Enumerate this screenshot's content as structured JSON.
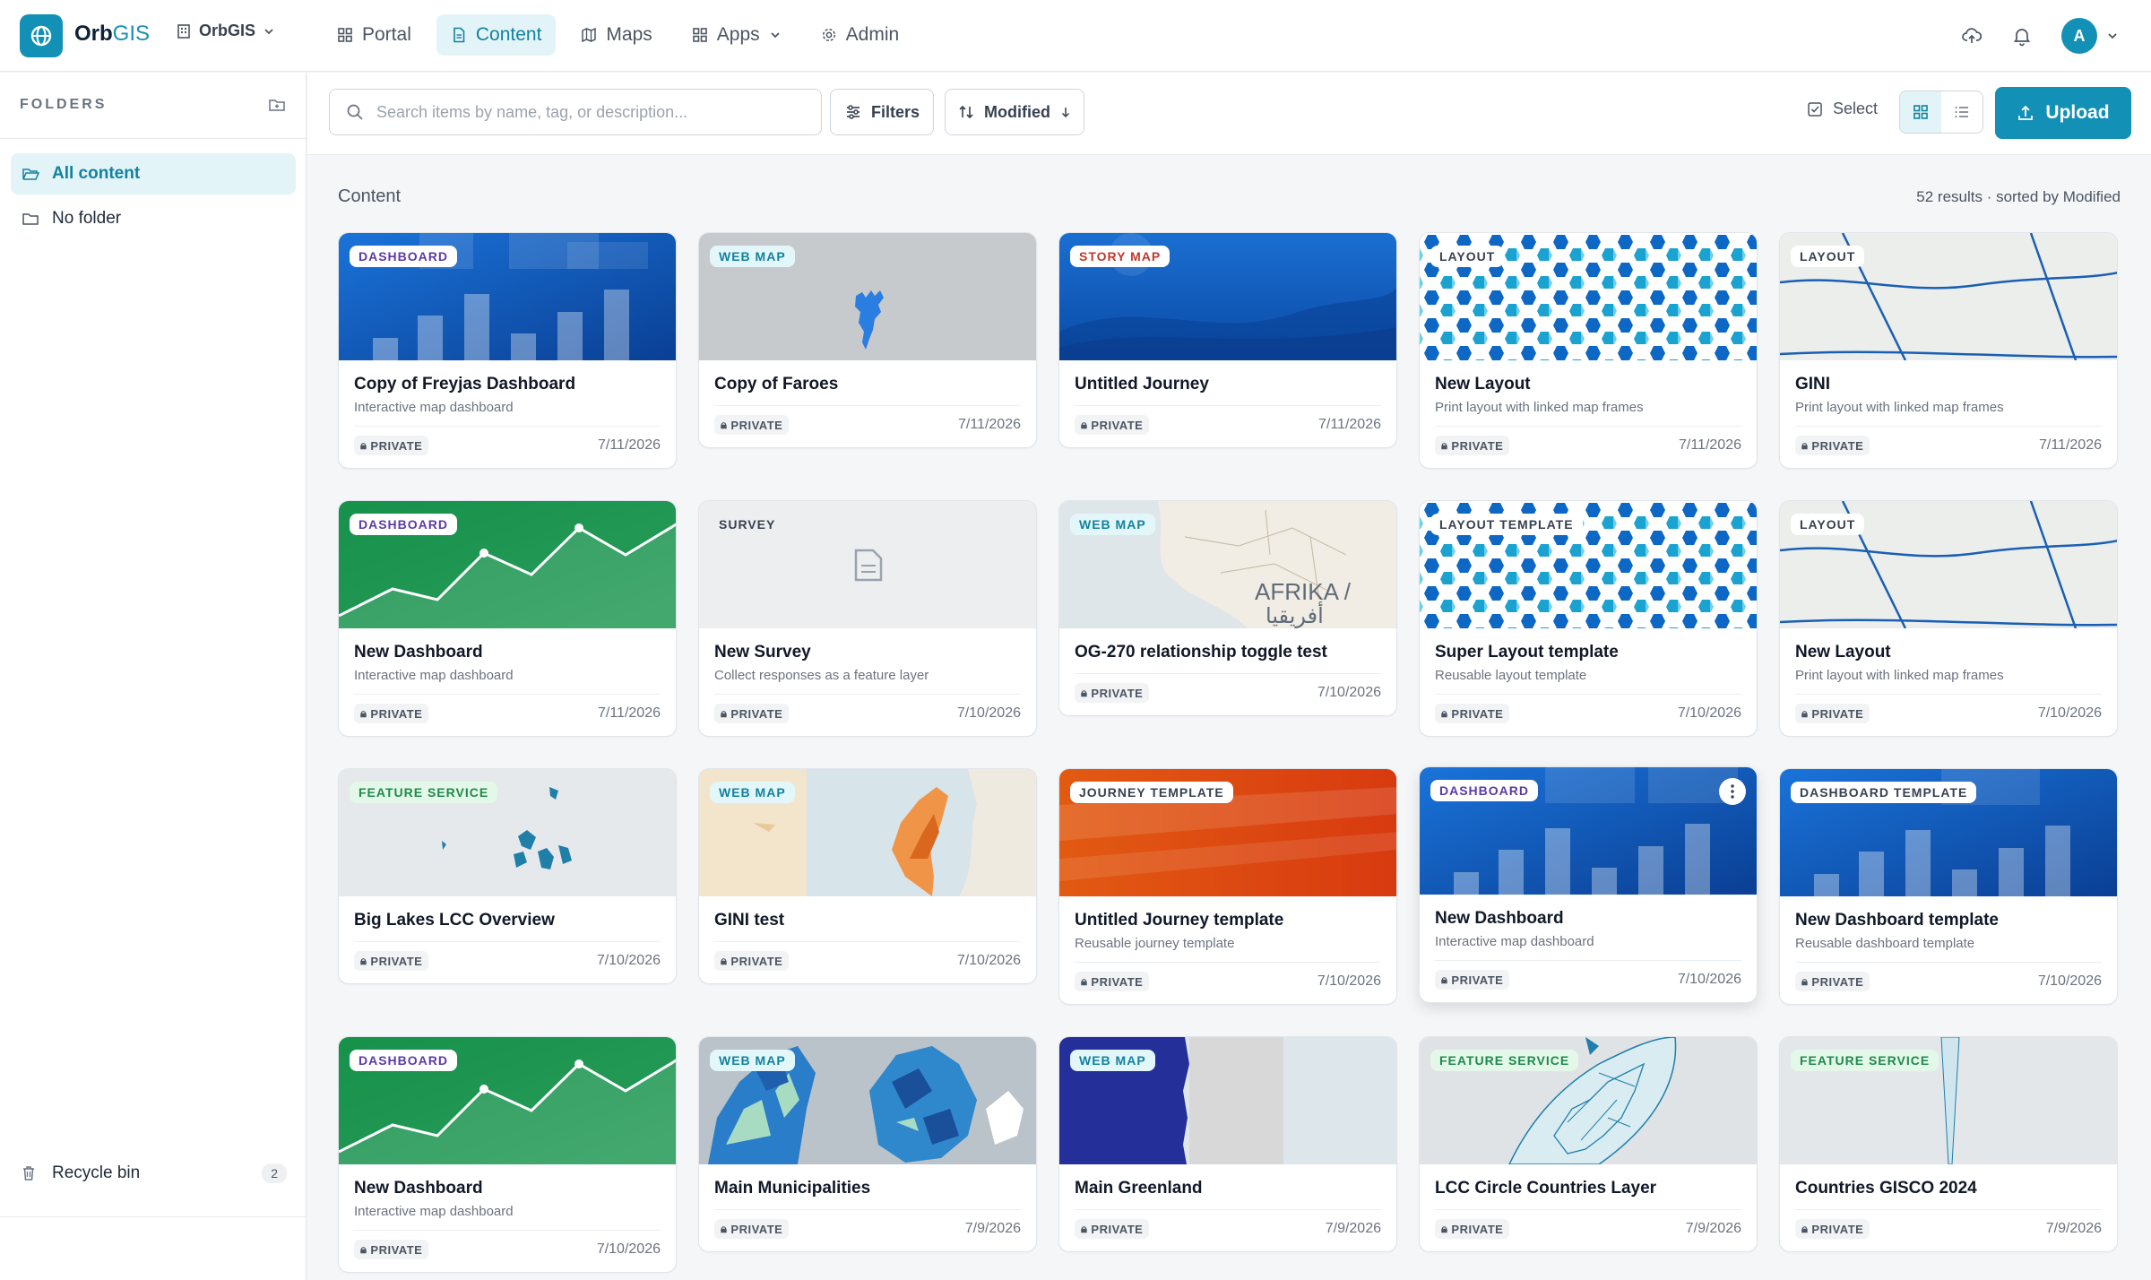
{
  "app": {
    "brand_main": "Orb",
    "brand_accent": "GIS",
    "org_label": "OrbGIS",
    "nav": [
      {
        "label": "Portal",
        "icon": "grid-icon"
      },
      {
        "label": "Content",
        "icon": "document-icon",
        "active": true
      },
      {
        "label": "Maps",
        "icon": "map-icon"
      },
      {
        "label": "Apps",
        "icon": "apps-icon"
      },
      {
        "label": "Admin",
        "icon": "gear-icon"
      }
    ],
    "avatar_initial": "A",
    "accent_color": "#1390b5"
  },
  "sidebar": {
    "heading": "FOLDERS",
    "items": [
      {
        "label": "All content",
        "active": true
      },
      {
        "label": "No folder"
      }
    ],
    "recycle_label": "Recycle bin",
    "recycle_count": "2"
  },
  "toolbar": {
    "search_placeholder": "Search items by name, tag, or description...",
    "filters_label": "Filters",
    "sort_label": "Modified",
    "select_label": "Select",
    "upload_label": "Upload"
  },
  "content": {
    "title": "Content",
    "results": "52 results · sorted by Modified"
  },
  "cards": [
    {
      "type": "DASHBOARD",
      "title": "Copy of Freyjas Dashboard",
      "subtitle": "Interactive map dashboard",
      "access": "PRIVATE",
      "date": "7/11/2026"
    },
    {
      "type": "WEB MAP",
      "title": "Copy of Faroes",
      "subtitle": "",
      "access": "PRIVATE",
      "date": "7/11/2026"
    },
    {
      "type": "STORY MAP",
      "title": "Untitled Journey",
      "subtitle": "",
      "access": "PRIVATE",
      "date": "7/11/2026"
    },
    {
      "type": "LAYOUT",
      "title": "New Layout",
      "subtitle": "Print layout with linked map frames",
      "access": "PRIVATE",
      "date": "7/11/2026"
    },
    {
      "type": "LAYOUT",
      "title": "GINI",
      "subtitle": "Print layout with linked map frames",
      "access": "PRIVATE",
      "date": "7/11/2026"
    },
    {
      "type": "DASHBOARD",
      "title": "New Dashboard",
      "subtitle": "Interactive map dashboard",
      "access": "PRIVATE",
      "date": "7/11/2026"
    },
    {
      "type": "SURVEY",
      "title": "New Survey",
      "subtitle": "Collect responses as a feature layer",
      "access": "PRIVATE",
      "date": "7/10/2026"
    },
    {
      "type": "WEB MAP",
      "title": "OG-270 relationship toggle test",
      "subtitle": "",
      "access": "PRIVATE",
      "date": "7/10/2026",
      "map_label": "AFRIKA /",
      "map_label_2": "أفريقيا"
    },
    {
      "type": "LAYOUT TEMPLATE",
      "title": "Super Layout template",
      "subtitle": "Reusable layout template",
      "access": "PRIVATE",
      "date": "7/10/2026"
    },
    {
      "type": "LAYOUT",
      "title": "New Layout",
      "subtitle": "Print layout with linked map frames",
      "access": "PRIVATE",
      "date": "7/10/2026"
    },
    {
      "type": "FEATURE SERVICE",
      "title": "Big Lakes LCC Overview",
      "subtitle": "",
      "access": "PRIVATE",
      "date": "7/10/2026"
    },
    {
      "type": "WEB MAP",
      "title": "GINI test",
      "subtitle": "",
      "access": "PRIVATE",
      "date": "7/10/2026"
    },
    {
      "type": "JOURNEY TEMPLATE",
      "title": "Untitled Journey template",
      "subtitle": "Reusable journey template",
      "access": "PRIVATE",
      "date": "7/10/2026"
    },
    {
      "type": "DASHBOARD",
      "title": "New Dashboard",
      "subtitle": "Interactive map dashboard",
      "access": "PRIVATE",
      "date": "7/10/2026"
    },
    {
      "type": "DASHBOARD TEMPLATE",
      "title": "New Dashboard template",
      "subtitle": "Reusable dashboard template",
      "access": "PRIVATE",
      "date": "7/10/2026"
    },
    {
      "type": "DASHBOARD",
      "title": "New Dashboard",
      "subtitle": "Interactive map dashboard",
      "access": "PRIVATE",
      "date": "7/10/2026"
    },
    {
      "type": "WEB MAP",
      "title": "Main Municipalities",
      "subtitle": "",
      "access": "PRIVATE",
      "date": "7/9/2026"
    },
    {
      "type": "WEB MAP",
      "title": "Main Greenland",
      "subtitle": "",
      "access": "PRIVATE",
      "date": "7/9/2026"
    },
    {
      "type": "FEATURE SERVICE",
      "title": "LCC Circle Countries Layer",
      "subtitle": "",
      "access": "PRIVATE",
      "date": "7/9/2026"
    },
    {
      "type": "FEATURE SERVICE",
      "title": "Countries GISCO 2024",
      "subtitle": "",
      "access": "PRIVATE",
      "date": "7/9/2026"
    }
  ]
}
